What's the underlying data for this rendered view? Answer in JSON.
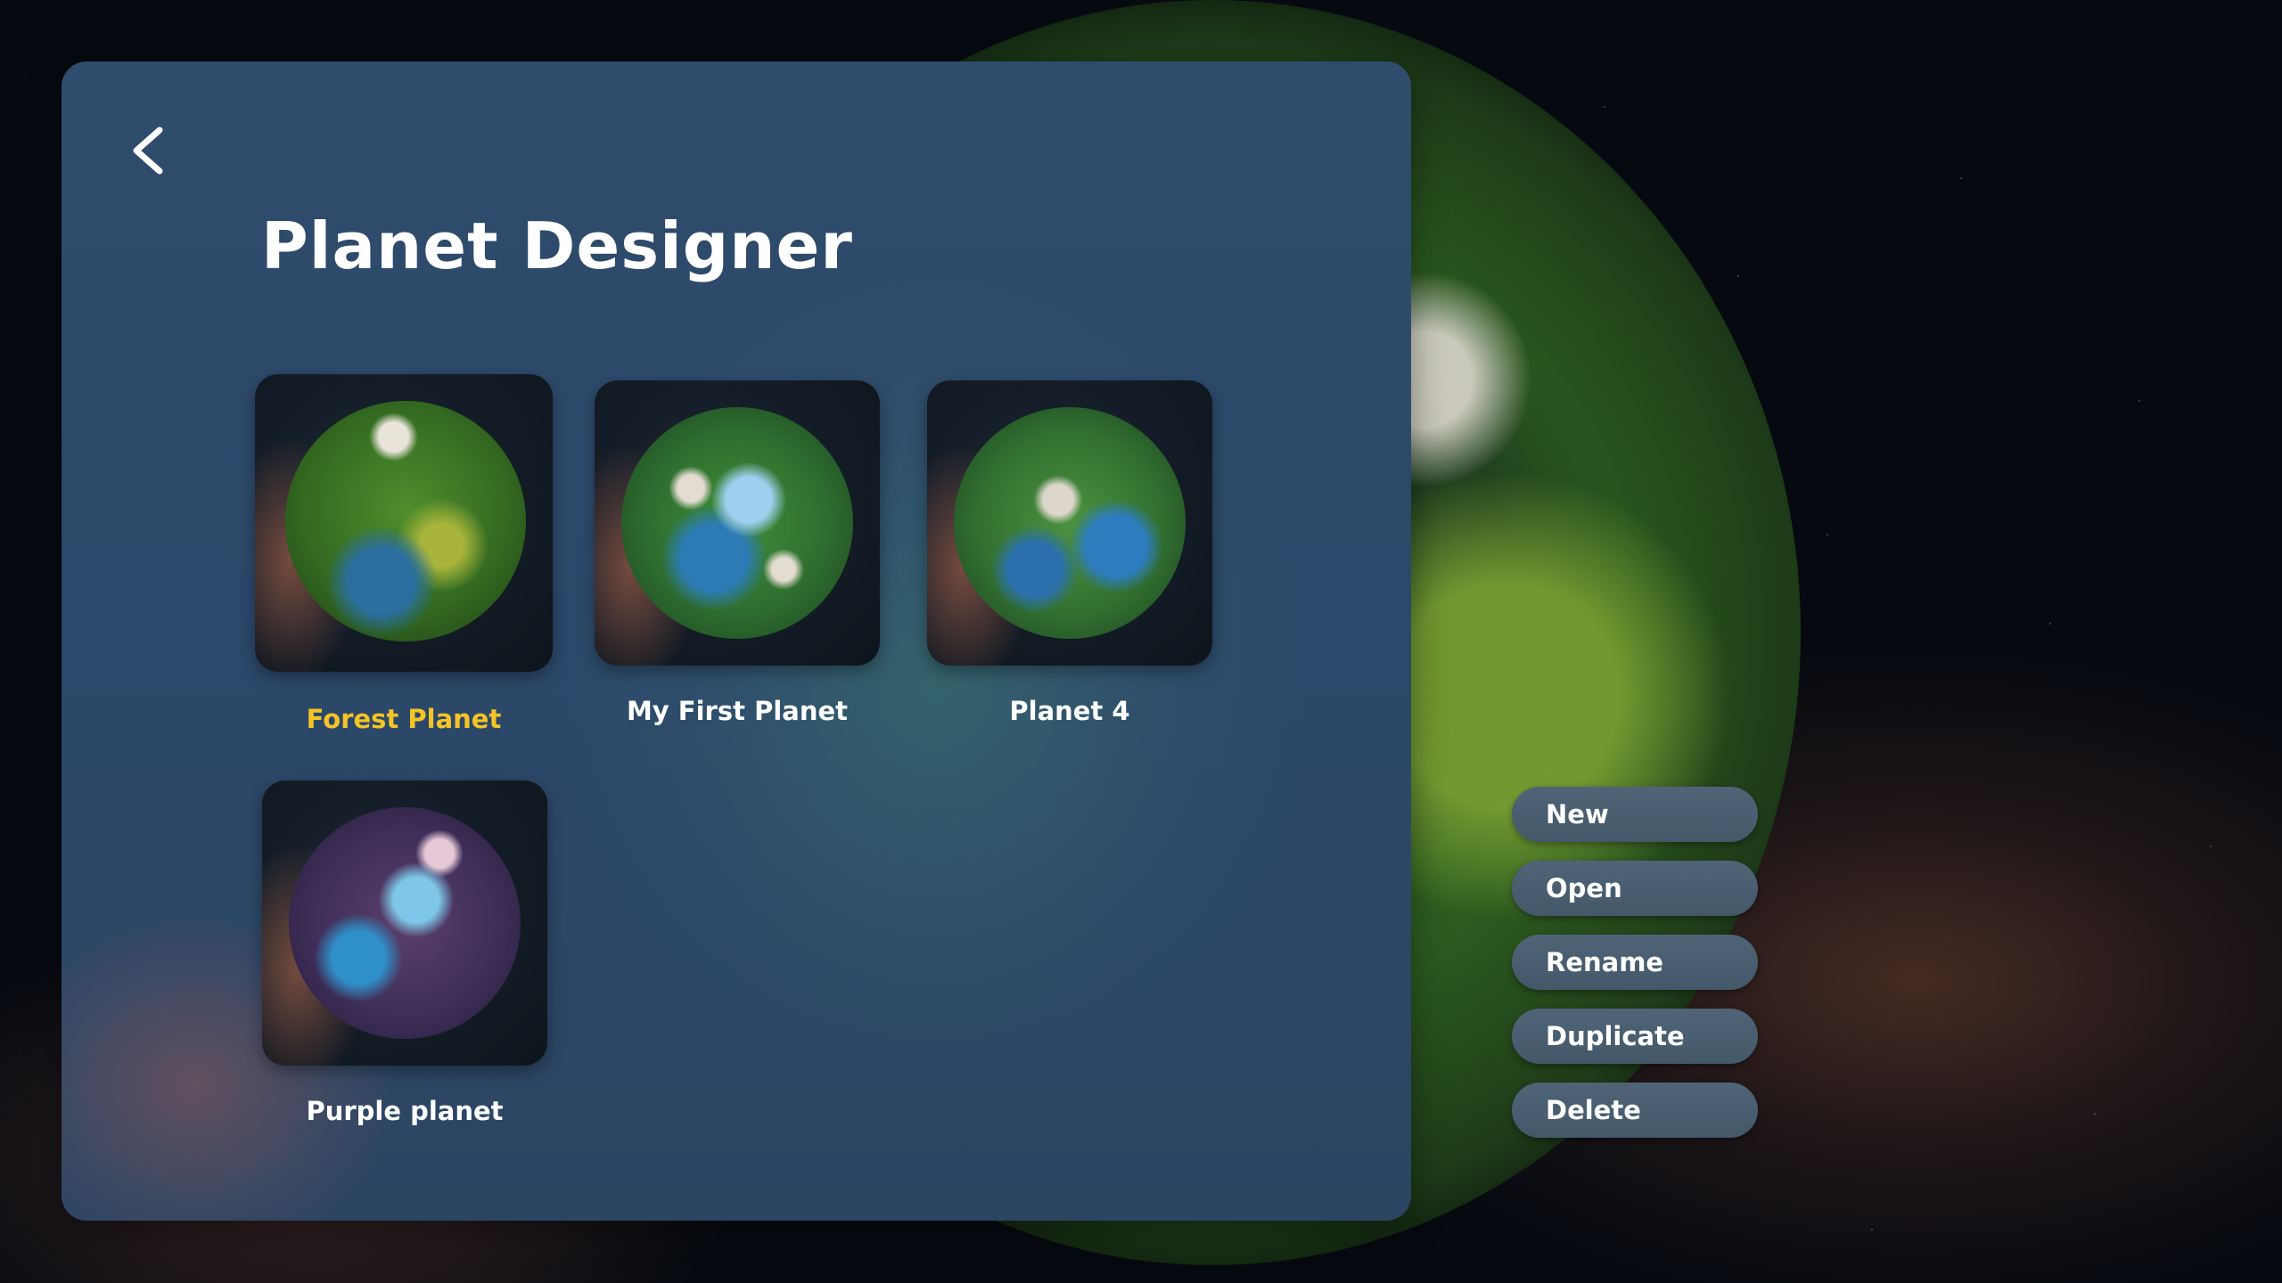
{
  "header": {
    "title": "Planet Designer",
    "back_icon": "chevron-left-icon"
  },
  "planets": [
    {
      "name": "Forest Planet",
      "selected": true
    },
    {
      "name": "My First Planet",
      "selected": false
    },
    {
      "name": "Planet 4",
      "selected": false
    },
    {
      "name": "Purple planet",
      "selected": false
    }
  ],
  "actions": {
    "new_label": "New",
    "open_label": "Open",
    "rename_label": "Rename",
    "duplicate_label": "Duplicate",
    "delete_label": "Delete"
  },
  "colors": {
    "selected_label": "#f5c425",
    "panel": "#2e4a6a",
    "button": "#4a5f72"
  }
}
